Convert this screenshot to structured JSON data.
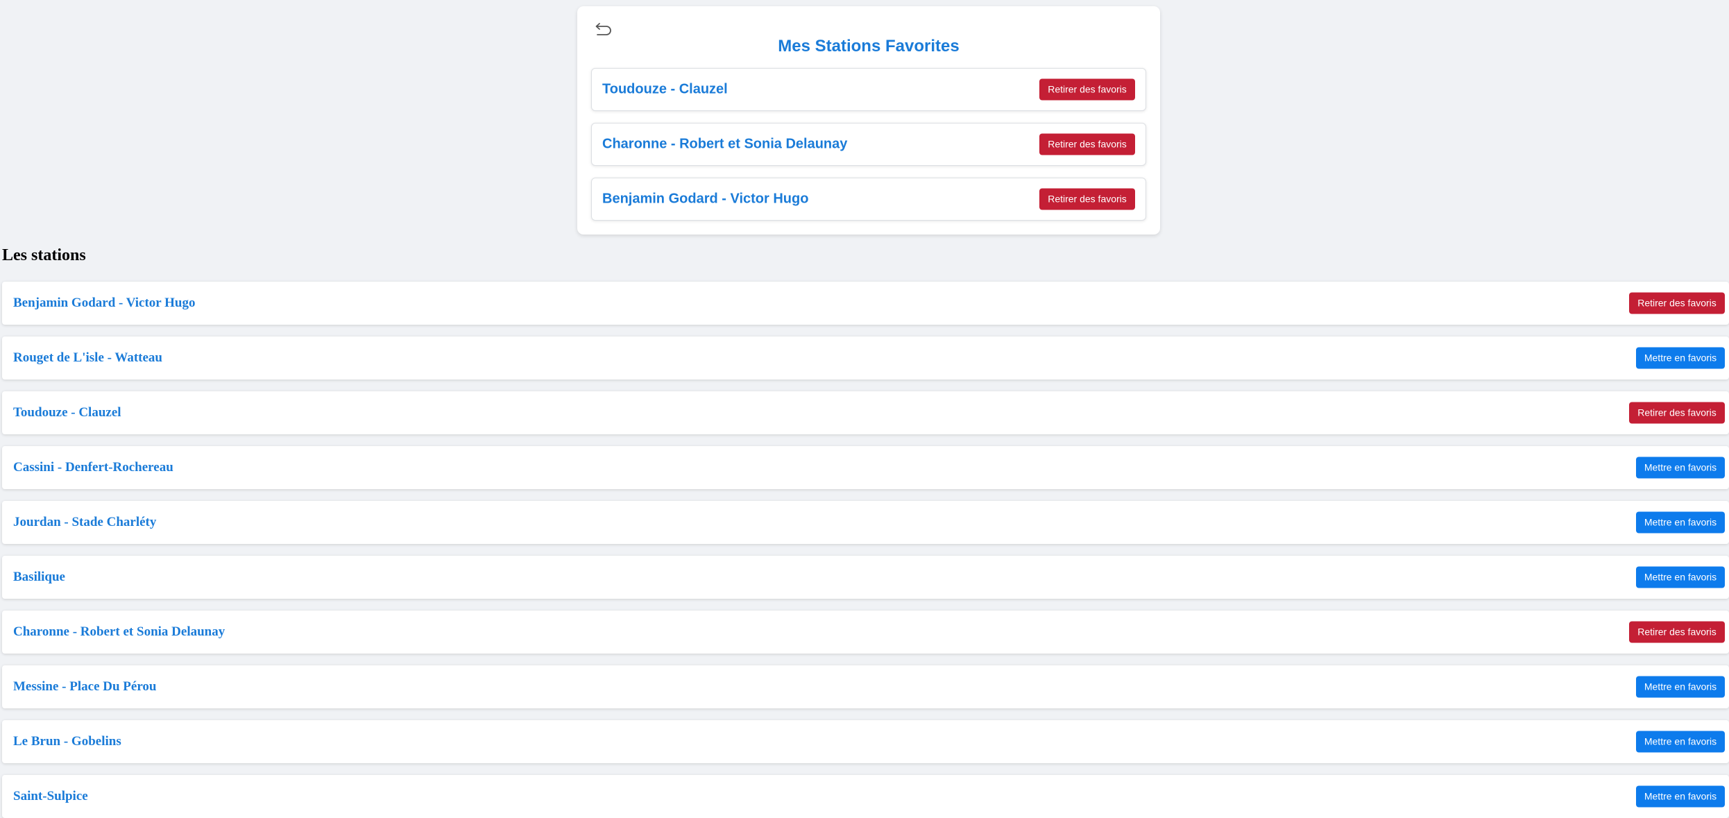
{
  "favorites": {
    "title": "Mes Stations Favorites",
    "back_icon": "undo-arrow-icon",
    "items": [
      {
        "name": "Toudouze - Clauzel",
        "button": "Retirer des favoris"
      },
      {
        "name": "Charonne - Robert et Sonia Delaunay",
        "button": "Retirer des favoris"
      },
      {
        "name": "Benjamin Godard - Victor Hugo",
        "button": "Retirer des favoris"
      }
    ]
  },
  "stations": {
    "title": "Les stations",
    "items": [
      {
        "name": "Benjamin Godard - Victor Hugo",
        "button": "Retirer des favoris",
        "favorite": true
      },
      {
        "name": "Rouget de L'isle - Watteau",
        "button": "Mettre en favoris",
        "favorite": false
      },
      {
        "name": "Toudouze - Clauzel",
        "button": "Retirer des favoris",
        "favorite": true
      },
      {
        "name": "Cassini - Denfert-Rochereau",
        "button": "Mettre en favoris",
        "favorite": false
      },
      {
        "name": "Jourdan - Stade Charléty",
        "button": "Mettre en favoris",
        "favorite": false
      },
      {
        "name": "Basilique",
        "button": "Mettre en favoris",
        "favorite": false
      },
      {
        "name": "Charonne - Robert et Sonia Delaunay",
        "button": "Retirer des favoris",
        "favorite": true
      },
      {
        "name": "Messine - Place Du Pérou",
        "button": "Mettre en favoris",
        "favorite": false
      },
      {
        "name": "Le Brun - Gobelins",
        "button": "Mettre en favoris",
        "favorite": false
      },
      {
        "name": "Saint-Sulpice",
        "button": "Mettre en favoris",
        "favorite": false
      }
    ]
  },
  "colors": {
    "background": "#f0f2f5",
    "link_blue": "#1a7bd8",
    "remove_red": "#c41f35",
    "add_blue": "#0d7bec"
  }
}
